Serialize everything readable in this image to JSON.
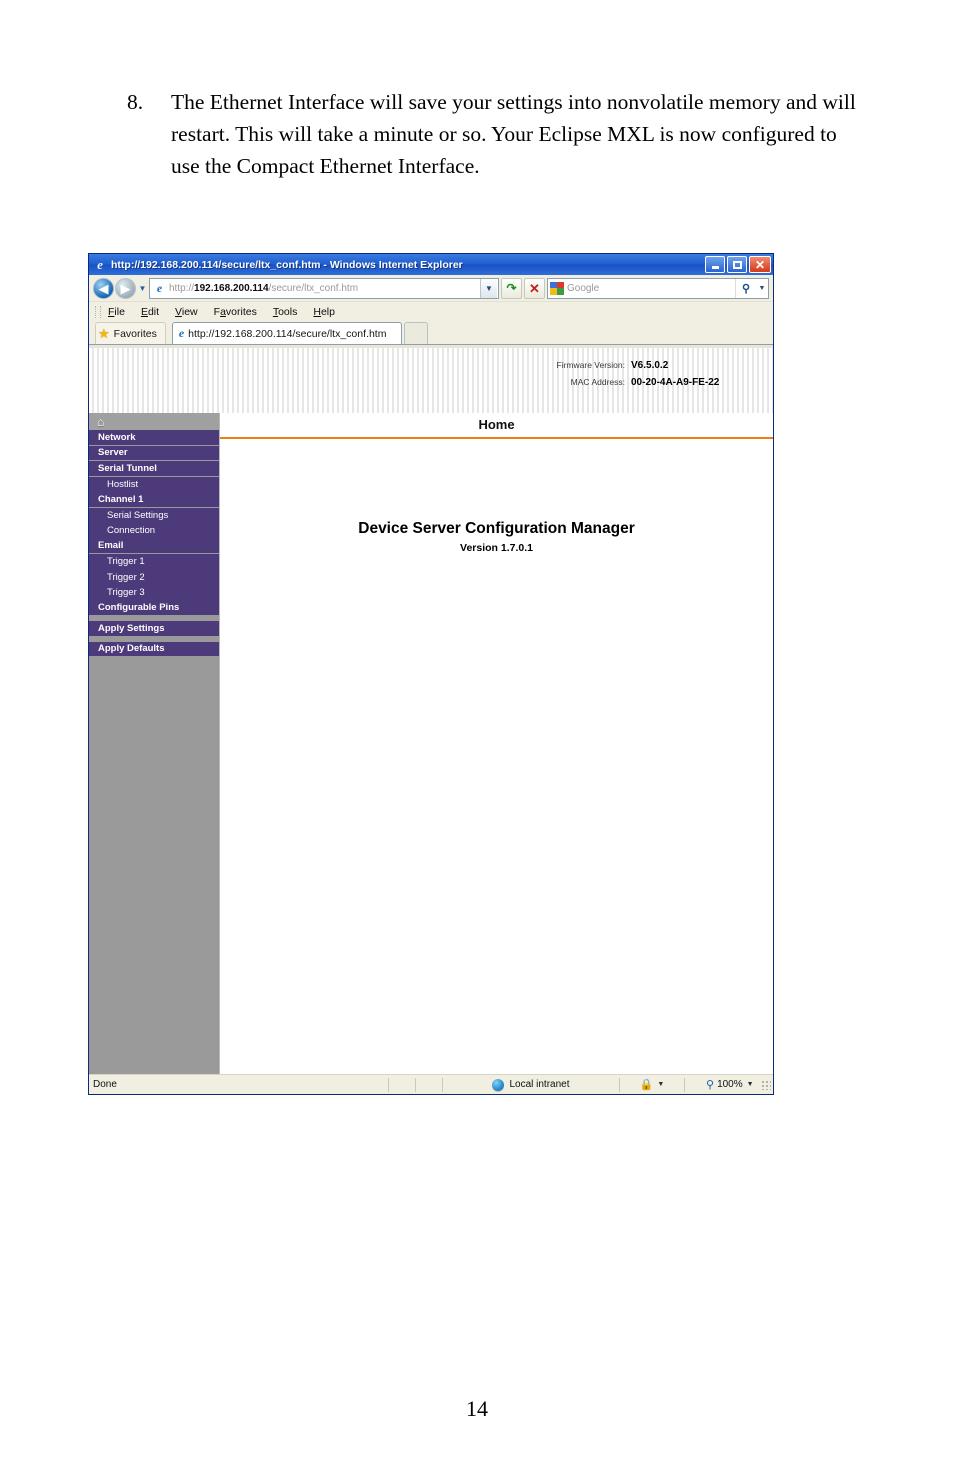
{
  "document": {
    "step_number": "8.",
    "step_text": "The Ethernet Interface will save your settings into nonvolatile memory and will restart.  This will take a minute or so.  Your Eclipse MXL is now configured to use the Compact Ethernet Interface.",
    "page_number": "14"
  },
  "browser": {
    "title": "http://192.168.200.114/secure/ltx_conf.htm - Windows Internet Explorer",
    "title_icon": "internet-explorer-icon",
    "window_buttons": {
      "minimize": "_",
      "maximize": "□",
      "close": "×"
    },
    "address_bar": {
      "scheme": "http://",
      "host": "192.168.200.114",
      "path": "/secure/ltx_conf.htm",
      "full_url": "http://192.168.200.114/secure/ltx_conf.htm"
    },
    "buttons": {
      "back": "◀",
      "forward": "▶",
      "history_dropdown": "▼",
      "refresh": "↻",
      "stop": "✕",
      "address_dropdown": "▼",
      "search_go": "⌕",
      "search_dropdown": "▼"
    },
    "search": {
      "provider": "Google",
      "placeholder": "Google",
      "value": ""
    },
    "menu": [
      {
        "label_pre": "",
        "accel": "F",
        "label_post": "ile"
      },
      {
        "label_pre": "",
        "accel": "E",
        "label_post": "dit"
      },
      {
        "label_pre": "",
        "accel": "V",
        "label_post": "iew"
      },
      {
        "label_pre": "F",
        "accel": "a",
        "label_post": "vorites"
      },
      {
        "label_pre": "",
        "accel": "T",
        "label_post": "ools"
      },
      {
        "label_pre": "",
        "accel": "H",
        "label_post": "elp"
      }
    ],
    "favorites": {
      "label": "Favorites",
      "icon": "star-icon"
    },
    "tab": {
      "label": "http://192.168.200.114/secure/ltx_conf.htm",
      "icon": "internet-explorer-icon"
    },
    "status_bar": {
      "status": "Done",
      "zone": "Local intranet",
      "zone_icon": "globe-icon",
      "protection_icon": "privacy-lock-icon",
      "zoom": "100%",
      "zoom_icon": "zoom-magnifier-icon",
      "caret": "▾"
    }
  },
  "page": {
    "info": [
      {
        "label": "Firmware Version:",
        "value": "V6.5.0.2"
      },
      {
        "label": "MAC Address:",
        "value": "00-20-4A-A9-FE-22"
      }
    ],
    "nav": {
      "home_icon": "home-icon",
      "items": [
        {
          "label": "Network",
          "sub": false,
          "gap_after": false
        },
        {
          "label": "Server",
          "sub": false,
          "gap_after": false
        },
        {
          "label": "Serial Tunnel",
          "sub": false,
          "gap_after": false
        },
        {
          "label": "Hostlist",
          "sub": true,
          "gap_after": false
        },
        {
          "label": "Channel 1",
          "sub": false,
          "gap_after": false
        },
        {
          "label": "Serial Settings",
          "sub": true,
          "gap_after": false
        },
        {
          "label": "Connection",
          "sub": true,
          "gap_after": false
        },
        {
          "label": "Email",
          "sub": false,
          "gap_after": false
        },
        {
          "label": "Trigger 1",
          "sub": true,
          "gap_after": false
        },
        {
          "label": "Trigger 2",
          "sub": true,
          "gap_after": false
        },
        {
          "label": "Trigger 3",
          "sub": true,
          "gap_after": false
        },
        {
          "label": "Configurable Pins",
          "sub": false,
          "gap_after": true
        },
        {
          "label": "Apply Settings",
          "sub": false,
          "gap_after": true
        },
        {
          "label": "Apply Defaults",
          "sub": false,
          "gap_after": true
        }
      ]
    },
    "main": {
      "heading": "Home",
      "device_title": "Device Server Configuration Manager",
      "device_version": "Version 1.7.0.1"
    }
  },
  "colors": {
    "nav_purple": "#4c3a7a",
    "nav_gray": "#9a9a9a",
    "accent_orange": "#f07d14",
    "titlebar_blue": "#1f5fd0"
  }
}
